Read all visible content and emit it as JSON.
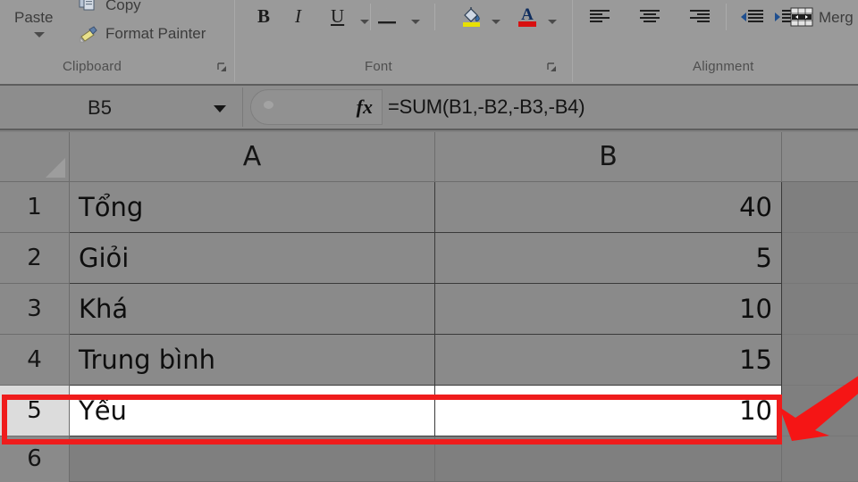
{
  "ribbon": {
    "groups": [
      {
        "name": "Clipboard",
        "label": "Clipboard"
      },
      {
        "name": "Font",
        "label": "Font"
      },
      {
        "name": "Alignment",
        "label": "Alignment"
      }
    ],
    "clipboard": {
      "paste_label": "Paste",
      "copy_label": "Copy",
      "format_painter_label": "Format Painter",
      "group_label": "Clipboard"
    },
    "font": {
      "bold_label": "B",
      "italic_label": "I",
      "underline_label": "U",
      "group_label": "Font",
      "fill_color": "#e8e000",
      "font_color": "#d81010"
    },
    "alignment": {
      "merge_label": "Merg",
      "group_label": "Alignment"
    }
  },
  "formula_bar": {
    "name_box_value": "B5",
    "fx_label": "fx",
    "formula_value": "=SUM(B1,-B2,-B3,-B4)"
  },
  "sheet": {
    "column_headers": [
      "A",
      "B",
      ""
    ],
    "row_headers": [
      "1",
      "2",
      "3",
      "4",
      "5",
      "6"
    ],
    "selected_cell": "B5",
    "rows": [
      {
        "num": "1",
        "a": "Tổng",
        "b": "40"
      },
      {
        "num": "2",
        "a": "Giỏi",
        "b": "5"
      },
      {
        "num": "3",
        "a": "Khá",
        "b": "10"
      },
      {
        "num": "4",
        "a": "Trung bình",
        "b": "15"
      },
      {
        "num": "5",
        "a": "Yếu",
        "b": "10"
      },
      {
        "num": "6",
        "a": "",
        "b": ""
      }
    ]
  },
  "annotations": {
    "highlight_color": "#ef1c1c",
    "arrow_color": "#f51515",
    "highlight_target": "row-5",
    "arrow_target": "cell-B5"
  }
}
